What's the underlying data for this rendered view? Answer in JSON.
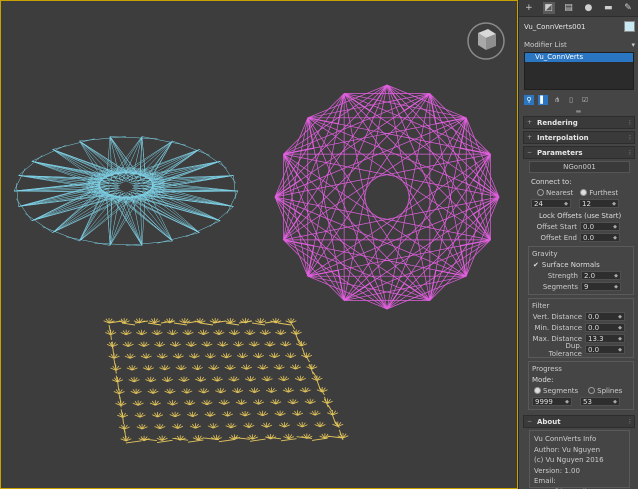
{
  "object_name": "Vu_ConnVerts001",
  "object_color": "#c9e9f2",
  "modifier_list_label": "Modifier List",
  "modifier_stack": [
    "Vu_ConnVerts"
  ],
  "rollouts": {
    "rendering": "Rendering",
    "interpolation": "Interpolation",
    "parameters": "Parameters",
    "about": "About"
  },
  "parameters": {
    "source_name": "NGon001",
    "connect_to_label": "Connect to:",
    "nearest_label": "Nearest",
    "furthest_label": "Furthest",
    "nearest_value": "24",
    "furthest_value": "12",
    "lock_offsets_label": "Lock Offsets (use Start)",
    "offset_start_label": "Offset Start",
    "offset_start_value": "0.0",
    "offset_end_label": "Offset End",
    "offset_end_value": "0.0"
  },
  "gravity": {
    "title": "Gravity",
    "surface_normals_label": "Surface Normals",
    "strength_label": "Strength",
    "strength_value": "2.0",
    "segments_label": "Segments",
    "segments_value": "9"
  },
  "filter": {
    "title": "Filter",
    "vert_distance_label": "Vert. Distance",
    "vert_distance_value": "0.0",
    "min_distance_label": "Min. Distance",
    "min_distance_value": "0.0",
    "max_distance_label": "Max. Distance",
    "max_distance_value": "13.3",
    "dup_tolerance_label": "Dup. Tolerance",
    "dup_tolerance_value": "0.0"
  },
  "progress": {
    "title": "Progress",
    "mode_label": "Mode:",
    "segments_label": "Segments",
    "splines_label": "Splines",
    "segments_value": "9999",
    "splines_value": "53"
  },
  "about": {
    "title": "Vu ConnVerts Info",
    "author": "Author: Vu Nguyen",
    "copyright": "(c) Vu Nguyen 2016",
    "version": "Version: 1.00",
    "email": "Email: vusta@hotmail.com"
  },
  "colors": {
    "viewport_border": "#c9a100",
    "cyan_object": "#7fd3e8",
    "magenta_object": "#e25fe0",
    "yellow_object": "#e3c55a",
    "selection_blue": "#2b76c2"
  }
}
